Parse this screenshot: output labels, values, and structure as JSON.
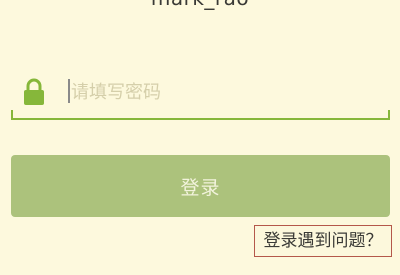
{
  "account": {
    "username": "mark_rao"
  },
  "password": {
    "placeholder": "请填写密码",
    "value": "",
    "icon": "lock-icon"
  },
  "login": {
    "button_label": "登录"
  },
  "help": {
    "link_label": "登录遇到问题？"
  },
  "colors": {
    "background": "#fdf9dd",
    "accent": "#86b73a",
    "button": "#acc27c",
    "button_text": "#f2f3dc",
    "placeholder": "#d5cfaa"
  }
}
